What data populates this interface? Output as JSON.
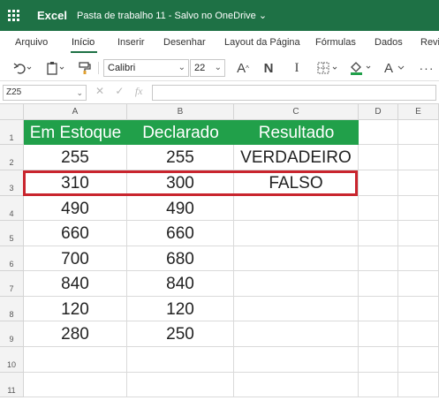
{
  "titlebar": {
    "app_name": "Excel",
    "doc_title": "Pasta de trabalho 11  -  Salvo no OneDrive  ⌄",
    "bg_color": "#1e7145"
  },
  "menu": {
    "tabs": [
      "Arquivo",
      "Início",
      "Inserir",
      "Desenhar",
      "Layout da Página",
      "Fórmulas",
      "Dados",
      "Revi"
    ],
    "active_tab": "Início"
  },
  "toolbar": {
    "font_name": "Calibri",
    "font_size": "22",
    "grow_font_glyph": "A",
    "bold_glyph": "N",
    "italic_glyph": "I",
    "font_color_glyph": "A"
  },
  "formula_bar": {
    "name_box": "Z25",
    "cancel_glyph": "✕",
    "enter_glyph": "✓",
    "fx_label": "fx",
    "formula_value": ""
  },
  "sheet": {
    "column_headers": [
      "A",
      "B",
      "C",
      "D",
      "E"
    ],
    "row_headers": [
      "1",
      "2",
      "3",
      "4",
      "5",
      "6",
      "7",
      "8",
      "9",
      "10",
      "11"
    ],
    "header_row": [
      "Em Estoque",
      "Declarado",
      "Resultado"
    ],
    "header_fill": "#21a04a",
    "rows": [
      [
        "255",
        "255",
        "VERDADEIRO"
      ],
      [
        "310",
        "300",
        "FALSO"
      ],
      [
        "490",
        "490",
        ""
      ],
      [
        "660",
        "660",
        ""
      ],
      [
        "700",
        "680",
        ""
      ],
      [
        "840",
        "840",
        ""
      ],
      [
        "120",
        "120",
        ""
      ],
      [
        "280",
        "250",
        ""
      ]
    ],
    "highlight_color": "#c9252e"
  }
}
